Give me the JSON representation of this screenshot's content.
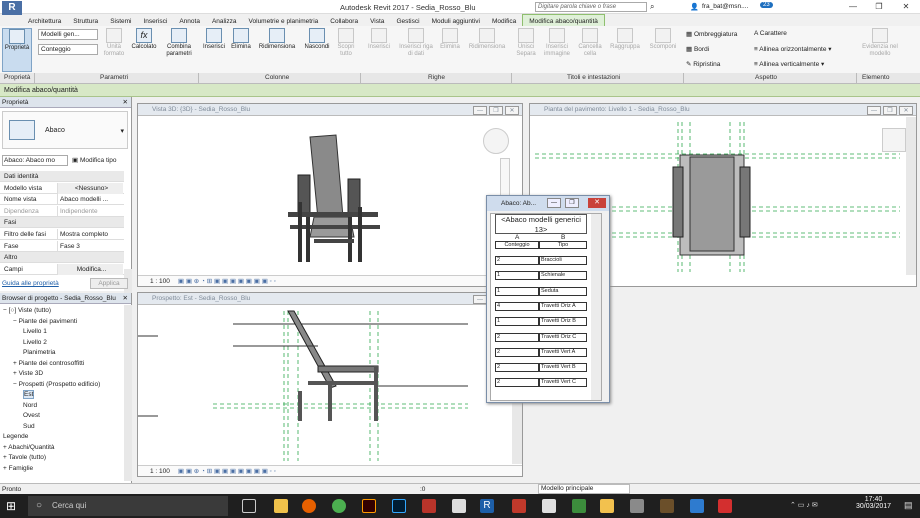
{
  "app": {
    "title": "Autodesk Revit 2017 -     Sedia_Rosso_Blu",
    "search_placeholder": "Digitare parola chiave o frase",
    "user": "fra_bat@msn....",
    "notif_count": "23",
    "logo": "R"
  },
  "tabs": [
    "Architettura",
    "Struttura",
    "Sistemi",
    "Inserisci",
    "Annota",
    "Analizza",
    "Volumetrie e planimetria",
    "Collabora",
    "Vista",
    "Gestisci",
    "Moduli aggiuntivi",
    "Modifica",
    "Modifica abaco/quantità"
  ],
  "ribbon": {
    "proprieta": "Proprietà",
    "modelli": "Modelli gen...",
    "conteggio": "Conteggio",
    "unita": "Unità formato",
    "calcolato": "Calcolato",
    "combina": "Combina parametri",
    "inserisci": "Inserisci",
    "elimina": "Elimina",
    "ridimensiona": "Ridimensiona",
    "nascondi": "Nascondi",
    "scopri": "Scopri tutto",
    "ins_righe": "Inserisci",
    "ins_riga_dati": "Inserisci riga di dati",
    "elim_righe": "Elimina",
    "ridim_righe": "Ridimensiona",
    "unisci": "Unisci Separa",
    "ins_immagine": "Inserisci immagine",
    "cancella_cella": "Cancella cella",
    "raggruppa": "Raggruppa",
    "scomponi": "Scomponi",
    "ombreggiatura": "Ombreggiatura",
    "bordi": "Bordi",
    "ripristina": "Ripristina",
    "carattere": "Carattere",
    "allinea_o": "Allinea orizzontalmente",
    "allinea_v": "Allinea verticalmente",
    "evidenzia": "Evidenzia nel modello"
  },
  "panels": [
    "Proprietà",
    "Parametri",
    "Colonne",
    "Righe",
    "Titoli e intestazioni",
    "Aspetto",
    "Elemento"
  ],
  "mode_bar": "Modifica abaco/quantità",
  "properties": {
    "header": "Proprietà",
    "type_name": "Abaco",
    "selector": "Abaco: Abaco mo",
    "edit_type": "Modifica tipo",
    "rows": [
      {
        "k": "Dati identità",
        "v": "",
        "section": true
      },
      {
        "k": "Modello vista",
        "v": "<Nessuno>"
      },
      {
        "k": "Nome vista",
        "v": "Abaco modelli ..."
      },
      {
        "k": "Dipendenza",
        "v": "Indipendente"
      },
      {
        "k": "Fasi",
        "v": "",
        "section": true
      },
      {
        "k": "Filtro delle fasi",
        "v": "Mostra completo"
      },
      {
        "k": "Fase",
        "v": "Fase 3"
      },
      {
        "k": "Altro",
        "v": "",
        "section": true
      },
      {
        "k": "Campi",
        "v": "Modifica..."
      }
    ],
    "help": "Guida alle proprietà",
    "apply": "Applica"
  },
  "browser": {
    "header": "Browser di progetto - Sedia_Rosso_Blu",
    "items": [
      {
        "t": "[○] Viste (tutto)",
        "d": 0,
        "sign": "−"
      },
      {
        "t": "Piante dei pavimenti",
        "d": 1,
        "sign": "−"
      },
      {
        "t": "Livello 1",
        "d": 2,
        "sign": ""
      },
      {
        "t": "Livello 2",
        "d": 2,
        "sign": ""
      },
      {
        "t": "Planimetria",
        "d": 2,
        "sign": ""
      },
      {
        "t": "Piante dei controsoffitti",
        "d": 1,
        "sign": "+"
      },
      {
        "t": "Viste 3D",
        "d": 1,
        "sign": "+"
      },
      {
        "t": "Prospetti (Prospetto edificio)",
        "d": 1,
        "sign": "−"
      },
      {
        "t": "Est",
        "d": 2,
        "sign": ""
      },
      {
        "t": "Nord",
        "d": 2,
        "sign": ""
      },
      {
        "t": "Ovest",
        "d": 2,
        "sign": ""
      },
      {
        "t": "Sud",
        "d": 2,
        "sign": ""
      },
      {
        "t": "Legende",
        "d": 0,
        "sign": ""
      },
      {
        "t": "Abachi/Quantità",
        "d": 0,
        "sign": "+"
      },
      {
        "t": "Tavole (tutto)",
        "d": 0,
        "sign": "+"
      },
      {
        "t": "Famiglie",
        "d": 0,
        "sign": "+"
      }
    ]
  },
  "views": {
    "v3d": "Vista 3D: {3D} - Sedia_Rosso_Blu",
    "plan": "Pianta del pavimento: Livello 1 - Sedia_Rosso_Blu",
    "elev": "Prospetto: Est - Sedia_Rosso_Blu",
    "scale": "1 : 100"
  },
  "schedule": {
    "title": "Abaco: Ab...",
    "heading": "<Abaco modelli generici 13>",
    "col_a": "A",
    "col_b": "B",
    "h_a": "Conteggio",
    "h_b": "Tipo",
    "rows": [
      {
        "a": "2",
        "b": "Braccioli"
      },
      {
        "a": "1",
        "b": "Schienale"
      },
      {
        "a": "1",
        "b": "Seduta"
      },
      {
        "a": "4",
        "b": "Travetti Oriz A"
      },
      {
        "a": "1",
        "b": "Travetti Oriz B"
      },
      {
        "a": "2",
        "b": "Travetti Oriz C"
      },
      {
        "a": "2",
        "b": "Travetti Vert A"
      },
      {
        "a": "2",
        "b": "Travetti Vert B"
      },
      {
        "a": "2",
        "b": "Travetti Vert C"
      }
    ]
  },
  "status": {
    "left": "Pronto",
    "mid": ":0",
    "model": "Modello principale"
  },
  "taskbar": {
    "search": "Cerca qui",
    "time": "17:40",
    "date": "30/03/2017"
  },
  "colors": {
    "accent": "#8fbf6f",
    "revit_blue": "#4a6fa5",
    "grid_green": "#2fa84f"
  }
}
